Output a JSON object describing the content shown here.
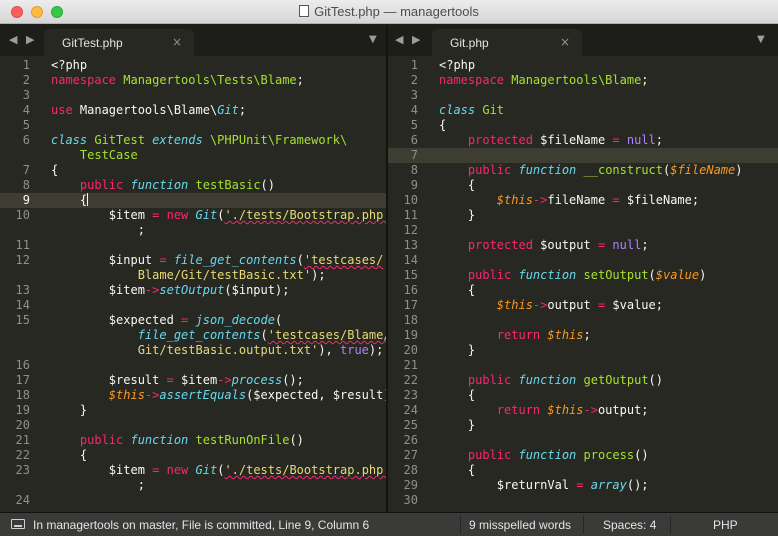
{
  "window": {
    "title": "GitTest.php — managertools"
  },
  "nav": {
    "back": "◀",
    "forward": "▶"
  },
  "left_pane": {
    "tab_label": "GitTest.php",
    "close_glyph": "×",
    "menu_glyph": "▼",
    "lines": [
      {
        "n": "1",
        "t": [
          [
            "<?php",
            ""
          ]
        ]
      },
      {
        "n": "",
        "t": [
          [
            "namespace ",
            "k"
          ],
          [
            "Managertools\\Tests\\Blame",
            "f"
          ],
          [
            ";",
            ""
          ]
        ]
      },
      {
        "n": "3",
        "t": []
      },
      {
        "n": "4",
        "t": [
          [
            "use ",
            "k"
          ],
          [
            "Managertools\\Blame\\",
            ""
          ],
          [
            "Git",
            "c"
          ],
          [
            ";",
            ""
          ]
        ]
      },
      {
        "n": "5",
        "t": []
      },
      {
        "n": "6",
        "t": [
          [
            "class ",
            "c"
          ],
          [
            "GitTest ",
            "f"
          ],
          [
            "extends ",
            "c"
          ],
          [
            "\\PHPUnit\\Framework\\",
            "f"
          ]
        ]
      },
      {
        "n": "",
        "t": [
          [
            "    TestCase",
            "f"
          ]
        ]
      },
      {
        "n": "7",
        "t": [
          [
            "{",
            ""
          ]
        ]
      },
      {
        "n": "8",
        "t": [
          [
            "    ",
            ""
          ],
          [
            "public ",
            "k"
          ],
          [
            "function ",
            "c"
          ],
          [
            "testBasic",
            "f"
          ],
          [
            "()",
            ""
          ]
        ]
      },
      {
        "n": "9",
        "t": [
          [
            "    {",
            ""
          ]
        ],
        "cursor": true
      },
      {
        "n": "10",
        "t": [
          [
            "        $item ",
            ""
          ],
          [
            "= ",
            "k"
          ],
          [
            "new ",
            "k"
          ],
          [
            "Git",
            "c"
          ],
          [
            "(",
            ""
          ],
          [
            "'./tests/Bootstrap.php'",
            "s"
          ],
          [
            ")",
            ""
          ]
        ]
      },
      {
        "n": "",
        "t": [
          [
            "            ;",
            ""
          ]
        ]
      },
      {
        "n": "11",
        "t": []
      },
      {
        "n": "12",
        "t": [
          [
            "        $input ",
            ""
          ],
          [
            "= ",
            "k"
          ],
          [
            "file_get_contents",
            "c"
          ],
          [
            "(",
            ""
          ],
          [
            "'testcases/",
            "s"
          ]
        ]
      },
      {
        "n": "",
        "t": [
          [
            "            Blame/Git/testBasic.txt'",
            "s"
          ],
          [
            ");",
            ""
          ]
        ]
      },
      {
        "n": "13",
        "t": [
          [
            "        $item",
            ""
          ],
          [
            "->",
            "k"
          ],
          [
            "setOutput",
            "c"
          ],
          [
            "($input);",
            ""
          ]
        ]
      },
      {
        "n": "14",
        "t": []
      },
      {
        "n": "15",
        "t": [
          [
            "        $expected ",
            ""
          ],
          [
            "= ",
            "k"
          ],
          [
            "json_decode",
            "c"
          ],
          [
            "(",
            ""
          ]
        ]
      },
      {
        "n": "",
        "t": [
          [
            "            ",
            ""
          ],
          [
            "file_get_contents",
            "c"
          ],
          [
            "(",
            ""
          ],
          [
            "'testcases/Blame/",
            "s"
          ]
        ]
      },
      {
        "n": "",
        "t": [
          [
            "            Git/testBasic.output.txt'",
            "s"
          ],
          [
            "), ",
            ""
          ],
          [
            "true",
            "n"
          ],
          [
            ");",
            ""
          ]
        ]
      },
      {
        "n": "16",
        "t": []
      },
      {
        "n": "17",
        "t": [
          [
            "        $result ",
            ""
          ],
          [
            "= ",
            "k"
          ],
          [
            "$item",
            ""
          ],
          [
            "->",
            "k"
          ],
          [
            "process",
            "c"
          ],
          [
            "();",
            ""
          ]
        ]
      },
      {
        "n": "18",
        "t": [
          [
            "        ",
            ""
          ],
          [
            "$this",
            "v"
          ],
          [
            "->",
            "k"
          ],
          [
            "assertEquals",
            "c"
          ],
          [
            "($expected, $result);",
            ""
          ]
        ]
      },
      {
        "n": "19",
        "t": [
          [
            "    }",
            ""
          ]
        ]
      },
      {
        "n": "20",
        "t": []
      },
      {
        "n": "21",
        "t": [
          [
            "    ",
            ""
          ],
          [
            "public ",
            "k"
          ],
          [
            "function ",
            "c"
          ],
          [
            "testRunOnFile",
            "f"
          ],
          [
            "()",
            ""
          ]
        ]
      },
      {
        "n": "22",
        "t": [
          [
            "    {",
            ""
          ]
        ]
      },
      {
        "n": "23",
        "t": [
          [
            "        $item ",
            ""
          ],
          [
            "= ",
            "k"
          ],
          [
            "new ",
            "k"
          ],
          [
            "Git",
            "c"
          ],
          [
            "(",
            ""
          ],
          [
            "'./tests/Bootstrap.php'",
            "s"
          ],
          [
            ")",
            ""
          ]
        ]
      },
      {
        "n": "",
        "t": [
          [
            "            ;",
            ""
          ]
        ]
      },
      {
        "n": "24",
        "t": []
      }
    ]
  },
  "right_pane": {
    "tab_label": "Git.php",
    "close_glyph": "×",
    "menu_glyph": "▼",
    "lines": [
      {
        "n": "1",
        "t": [
          [
            "<?php",
            ""
          ]
        ]
      },
      {
        "n": "2",
        "t": [
          [
            "namespace ",
            "k"
          ],
          [
            "Managertools\\Blame",
            "f"
          ],
          [
            ";",
            ""
          ]
        ]
      },
      {
        "n": "3",
        "t": []
      },
      {
        "n": "4",
        "t": [
          [
            "class ",
            "c"
          ],
          [
            "Git",
            "f"
          ]
        ]
      },
      {
        "n": "5",
        "t": [
          [
            "{",
            ""
          ]
        ]
      },
      {
        "n": "6",
        "t": [
          [
            "    ",
            ""
          ],
          [
            "protected ",
            "k"
          ],
          [
            "$fileName ",
            ""
          ],
          [
            "= ",
            "k"
          ],
          [
            "null",
            "n"
          ],
          [
            ";",
            ""
          ]
        ]
      },
      {
        "n": "7",
        "t": [],
        "hl": true
      },
      {
        "n": "8",
        "t": [
          [
            "    ",
            ""
          ],
          [
            "public ",
            "k"
          ],
          [
            "function ",
            "c"
          ],
          [
            "__construct",
            "f"
          ],
          [
            "(",
            ""
          ],
          [
            "$fileName",
            "v"
          ],
          [
            ")",
            ""
          ]
        ]
      },
      {
        "n": "9",
        "t": [
          [
            "    {",
            ""
          ]
        ]
      },
      {
        "n": "10",
        "t": [
          [
            "        ",
            ""
          ],
          [
            "$this",
            "v"
          ],
          [
            "->",
            "k"
          ],
          [
            "fileName ",
            ""
          ],
          [
            "= ",
            "k"
          ],
          [
            "$fileName;",
            ""
          ]
        ]
      },
      {
        "n": "11",
        "t": [
          [
            "    }",
            ""
          ]
        ]
      },
      {
        "n": "12",
        "t": []
      },
      {
        "n": "13",
        "t": [
          [
            "    ",
            ""
          ],
          [
            "protected ",
            "k"
          ],
          [
            "$output ",
            ""
          ],
          [
            "= ",
            "k"
          ],
          [
            "null",
            "n"
          ],
          [
            ";",
            ""
          ]
        ]
      },
      {
        "n": "14",
        "t": []
      },
      {
        "n": "15",
        "t": [
          [
            "    ",
            ""
          ],
          [
            "public ",
            "k"
          ],
          [
            "function ",
            "c"
          ],
          [
            "setOutput",
            "f"
          ],
          [
            "(",
            ""
          ],
          [
            "$value",
            "v"
          ],
          [
            ")",
            ""
          ]
        ]
      },
      {
        "n": "16",
        "t": [
          [
            "    {",
            ""
          ]
        ]
      },
      {
        "n": "17",
        "t": [
          [
            "        ",
            ""
          ],
          [
            "$this",
            "v"
          ],
          [
            "->",
            "k"
          ],
          [
            "output ",
            ""
          ],
          [
            "= ",
            "k"
          ],
          [
            "$value;",
            ""
          ]
        ]
      },
      {
        "n": "18",
        "t": []
      },
      {
        "n": "19",
        "t": [
          [
            "        ",
            ""
          ],
          [
            "return ",
            "k"
          ],
          [
            "$this",
            "v"
          ],
          [
            ";",
            ""
          ]
        ]
      },
      {
        "n": "20",
        "t": [
          [
            "    }",
            ""
          ]
        ]
      },
      {
        "n": "21",
        "t": []
      },
      {
        "n": "22",
        "t": [
          [
            "    ",
            ""
          ],
          [
            "public ",
            "k"
          ],
          [
            "function ",
            "c"
          ],
          [
            "getOutput",
            "f"
          ],
          [
            "()",
            ""
          ]
        ]
      },
      {
        "n": "23",
        "t": [
          [
            "    {",
            ""
          ]
        ]
      },
      {
        "n": "24",
        "t": [
          [
            "        ",
            ""
          ],
          [
            "return ",
            "k"
          ],
          [
            "$this",
            "v"
          ],
          [
            "->",
            "k"
          ],
          [
            "output;",
            ""
          ]
        ]
      },
      {
        "n": "25",
        "t": [
          [
            "    }",
            ""
          ]
        ]
      },
      {
        "n": "26",
        "t": []
      },
      {
        "n": "27",
        "t": [
          [
            "    ",
            ""
          ],
          [
            "public ",
            "k"
          ],
          [
            "function ",
            "c"
          ],
          [
            "process",
            "f"
          ],
          [
            "()",
            ""
          ]
        ]
      },
      {
        "n": "28",
        "t": [
          [
            "    {",
            ""
          ]
        ]
      },
      {
        "n": "29",
        "t": [
          [
            "        $returnVal ",
            ""
          ],
          [
            "= ",
            "k"
          ],
          [
            "array",
            "c"
          ],
          [
            "();",
            ""
          ]
        ]
      },
      {
        "n": "30",
        "t": []
      }
    ]
  },
  "status": {
    "message": "In managertools on master, File is committed, Line 9, Column 6",
    "spelling": "9 misspelled words",
    "spaces": "Spaces: 4",
    "syntax": "PHP"
  }
}
